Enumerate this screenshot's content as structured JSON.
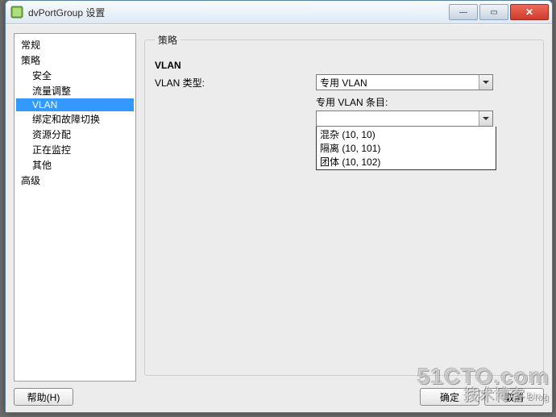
{
  "window": {
    "title": "dvPortGroup 设置"
  },
  "tree": {
    "nodes": [
      {
        "label": "常规",
        "level": 0
      },
      {
        "label": "策略",
        "level": 0
      },
      {
        "label": "安全",
        "level": 1
      },
      {
        "label": "流量调整",
        "level": 1
      },
      {
        "label": "VLAN",
        "level": 1,
        "selected": true
      },
      {
        "label": "绑定和故障切换",
        "level": 1
      },
      {
        "label": "资源分配",
        "level": 1
      },
      {
        "label": "正在监控",
        "level": 1
      },
      {
        "label": "其他",
        "level": 1
      },
      {
        "label": "高级",
        "level": 0
      }
    ]
  },
  "policy": {
    "legend": "策略",
    "vlan_heading": "VLAN",
    "vlan_type_label": "VLAN 类型:",
    "vlan_type_value": "专用 VLAN",
    "pvlan_entries_label": "专用 VLAN 条目:",
    "pvlan_selected": "",
    "pvlan_options": [
      "混杂 (10, 10)",
      "隔离 (10, 101)",
      "团体 (10, 102)"
    ]
  },
  "buttons": {
    "help": "帮助(H)",
    "ok": "确定",
    "cancel": "取消"
  },
  "watermark": {
    "line1": "51CTO.com",
    "line2_a": "技术博客",
    "line2_b": "Blog"
  }
}
